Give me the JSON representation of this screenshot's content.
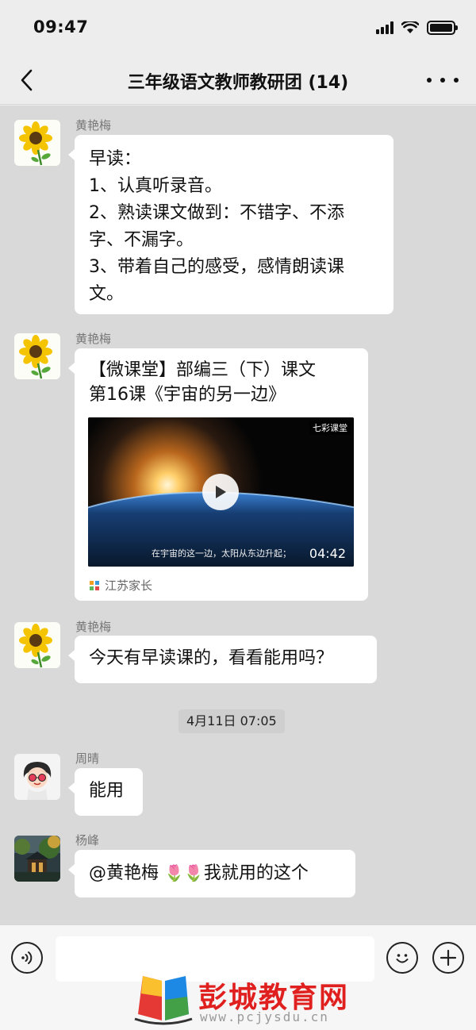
{
  "status_bar": {
    "time": "09:47",
    "signal_icon": "cellular-signal-icon",
    "wifi_icon": "wifi-icon",
    "battery_icon": "battery-icon"
  },
  "nav": {
    "back_icon": "chevron-left-icon",
    "title": "三年级语文教师教研团 (14)",
    "more_icon": "more-dots-icon"
  },
  "messages": [
    {
      "sender": "黄艳梅",
      "avatar": "sunflower-avatar",
      "lines": [
        "早读：",
        "1、认真听录音。",
        "2、熟读课文做到：不错字、不添",
        "字、不漏字。",
        "3、带着自己的感受，感情朗读课",
        "文。"
      ]
    },
    {
      "sender": "黄艳梅",
      "avatar": "sunflower-avatar",
      "card": {
        "title_line1": "【微课堂】部编三（下）课文",
        "title_line2": "第16课《宇宙的另一边》",
        "video_logo": "七彩课堂",
        "video_subtitle": "在宇宙的这一边，太阳从东边升起；",
        "duration": "04:42",
        "source": "江苏家长",
        "play_icon": "play-icon",
        "source_icon": "app-logo-icon"
      }
    },
    {
      "sender": "黄艳梅",
      "avatar": "sunflower-avatar",
      "text": "今天有早读课的，看看能用吗？"
    },
    {
      "timestamp": "4月11日 07:05"
    },
    {
      "sender": "周晴",
      "avatar": "cartoon-girl-avatar",
      "text": "能用"
    },
    {
      "sender": "杨峰",
      "avatar": "scenery-avatar",
      "text_before": "@黄艳梅 ",
      "emoji": "🌷🌷",
      "text_after": "我就用的这个"
    }
  ],
  "input_bar": {
    "voice_icon": "voice-icon",
    "placeholder": "",
    "emoji_icon": "smiley-icon",
    "plus_icon": "plus-icon"
  },
  "watermark": {
    "text": "彭城教育网",
    "url": "www.pcjysdu.cn"
  },
  "colors": {
    "chat_bg": "#d9d9d9",
    "bubble_bg": "#ffffff",
    "header_bg": "#ededed",
    "watermark_red": "#e0201f"
  }
}
